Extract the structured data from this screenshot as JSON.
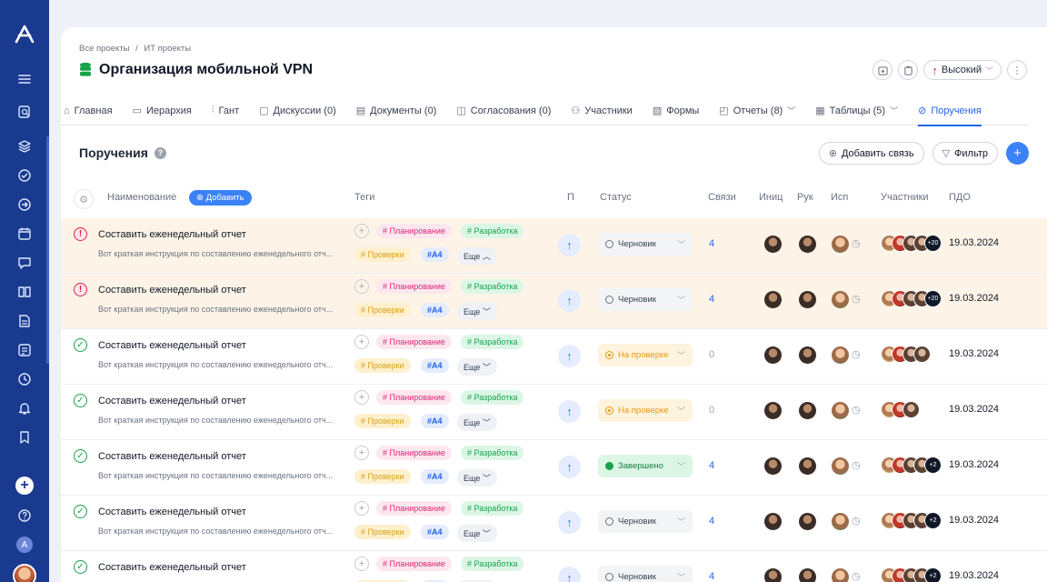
{
  "app": {
    "logo_letter": "A"
  },
  "breadcrumb": [
    "Все проекты",
    "/",
    "ИТ проекты"
  ],
  "project": {
    "title": "Организация мобильной VPN",
    "priority_label": "Высокий"
  },
  "tabs": [
    {
      "label": "Главная",
      "icon": "home-icon"
    },
    {
      "label": "Иерархия",
      "icon": "folder-icon"
    },
    {
      "label": "Гант",
      "icon": "gantt-icon"
    },
    {
      "label": "Дискуссии (0)",
      "icon": "chat-icon"
    },
    {
      "label": "Документы (0)",
      "icon": "document-icon"
    },
    {
      "label": "Согласования (0)",
      "icon": "book-icon"
    },
    {
      "label": "Участники",
      "icon": "users-icon"
    },
    {
      "label": "Формы",
      "icon": "form-icon"
    },
    {
      "label": "Отчеты (8)",
      "icon": "report-icon"
    },
    {
      "label": "Таблицы (5)",
      "icon": "table-icon"
    },
    {
      "label": "Поручения",
      "icon": "check-circle-icon"
    }
  ],
  "section": {
    "title": "Поручения",
    "add_link_label": "Добавить связь",
    "filter_label": "Фильтр"
  },
  "columns": {
    "name": "Наименование",
    "add": "Добавить",
    "tags": "Теги",
    "priority": "П",
    "status": "Статус",
    "links": "Связи",
    "initiator": "Иниц",
    "manager": "Рук",
    "executor": "Исп",
    "participants": "Участники",
    "deadline": "ПДО"
  },
  "tag_labels": {
    "planning": "# Планирование",
    "development": "# Разработка",
    "checks": "# Проверки",
    "a4": "#A4",
    "more": "Еще"
  },
  "rows": [
    {
      "title": "Составить еженедельный отчет",
      "desc": "Вот краткая инструкция по составлению еженедельного отч...",
      "state": "error",
      "status": "Черновик",
      "status_type": "draft",
      "links": "4",
      "more_open": true,
      "participants_count": "+20",
      "deadline": "19.03.2024"
    },
    {
      "title": "Составить еженедельный отчет",
      "desc": "Вот краткая инструкция по составлению еженедельного отч...",
      "state": "error",
      "status": "Черновик",
      "status_type": "draft",
      "links": "4",
      "more_open": false,
      "participants_count": "+20",
      "deadline": "19.03.2024"
    },
    {
      "title": "Составить еженедельный отчет",
      "desc": "Вот краткая инструкция по составлению еженедельного отч...",
      "state": "ok",
      "status": "На проверке",
      "status_type": "review",
      "links": "0",
      "more_open": false,
      "participants_count": "",
      "deadline": "19.03.2024"
    },
    {
      "title": "Составить еженедельный отчет",
      "desc": "Вот краткая инструкция по составлению еженедельного отч...",
      "state": "ok",
      "status": "На проверке",
      "status_type": "review",
      "links": "0",
      "more_open": false,
      "participants_count": "",
      "deadline": "19.03.2024"
    },
    {
      "title": "Составить еженедельный отчет",
      "desc": "Вот краткая инструкция по составлению еженедельного отч...",
      "state": "ok",
      "status": "Завершено",
      "status_type": "done",
      "links": "4",
      "more_open": false,
      "participants_count": "+2",
      "deadline": "19.03.2024"
    },
    {
      "title": "Составить еженедельный отчет",
      "desc": "Вот краткая инструкция по составлению еженедельного отч...",
      "state": "ok",
      "status": "Черновик",
      "status_type": "draft",
      "links": "4",
      "more_open": false,
      "participants_count": "+2",
      "deadline": "19.03.2024"
    },
    {
      "title": "Составить еженедельный отчет",
      "desc": "Вот краткая инструкция по составлению еженедельного отч...",
      "state": "ok",
      "status": "Черновик",
      "status_type": "draft",
      "links": "4",
      "more_open": false,
      "participants_count": "+2",
      "deadline": "19.03.2024"
    }
  ],
  "colors": {
    "rail": "#1a3a8f",
    "accent": "#2563eb",
    "warn_row": "#fdf4e7",
    "error": "#e11d48",
    "success": "#16a34a"
  }
}
